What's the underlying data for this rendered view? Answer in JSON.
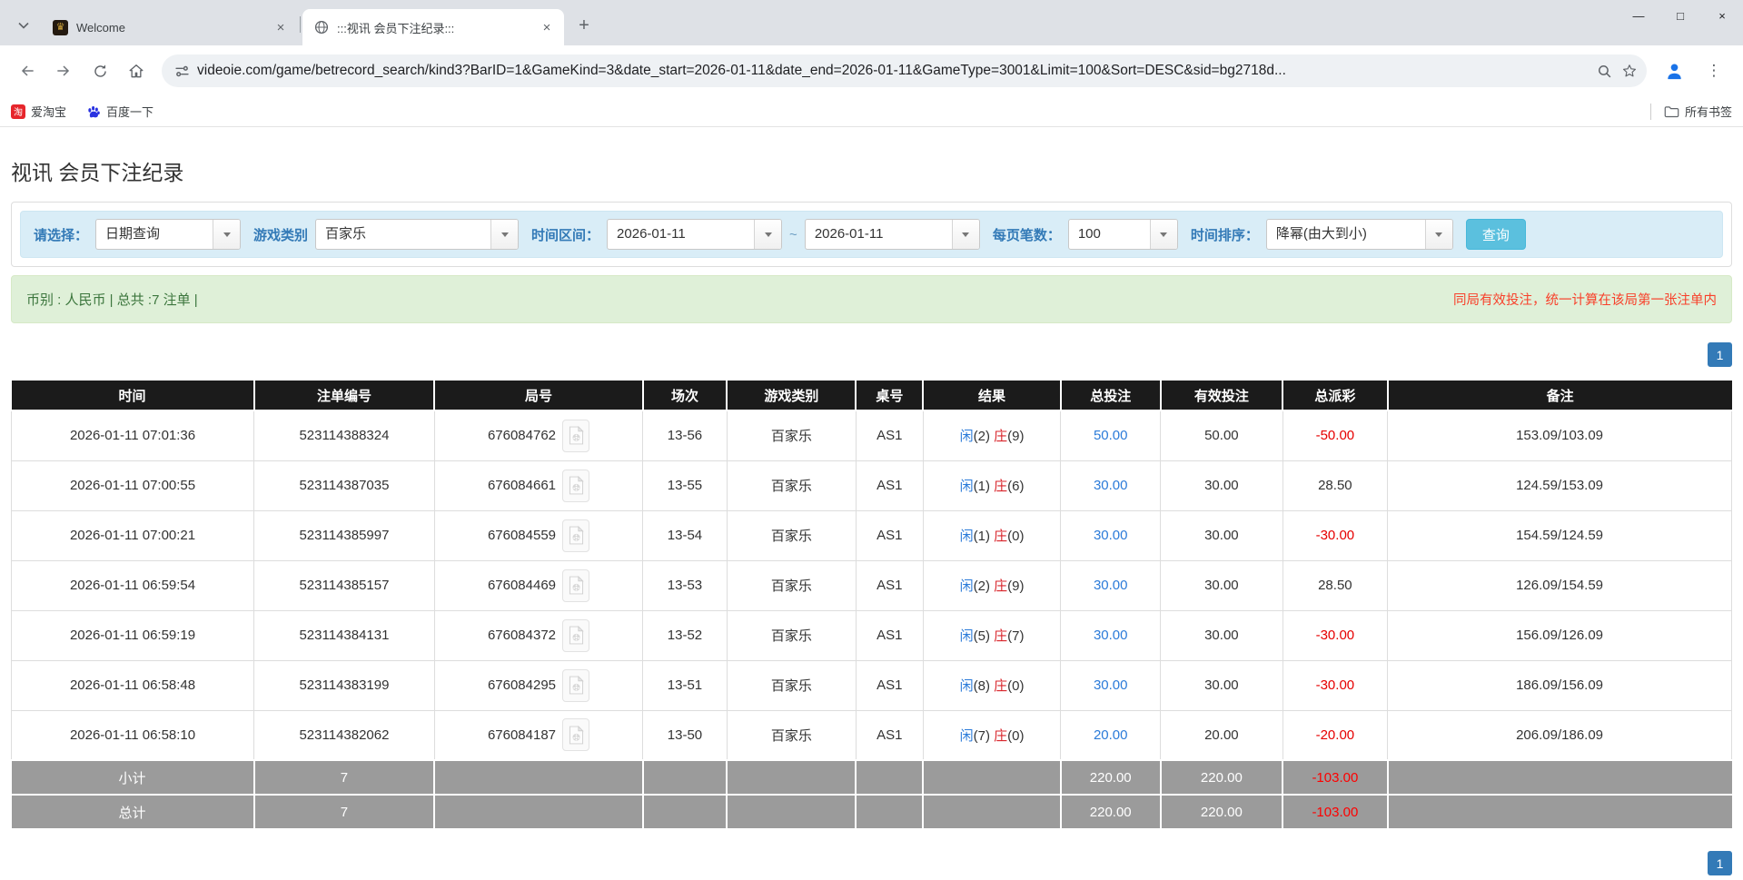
{
  "browser": {
    "tabs": [
      {
        "title": "Welcome"
      },
      {
        "title": ":::视讯 会员下注纪录:::"
      }
    ],
    "tab_close_glyph": "×",
    "new_tab_glyph": "+",
    "window_controls": {
      "minimize": "—",
      "maximize": "□",
      "close": "×"
    },
    "url": "videoie.com/game/betrecord_search/kind3?BarID=1&GameKind=3&date_start=2026-01-11&date_end=2026-01-11&GameType=3001&Limit=100&Sort=DESC&sid=bg2718d...",
    "bookmarks": [
      {
        "label": "爱淘宝",
        "icon": "taobao-icon",
        "icon_glyph": "淘"
      },
      {
        "label": "百度一下",
        "icon": "baidu-paw-icon"
      }
    ],
    "all_bookmarks": "所有书签"
  },
  "page": {
    "title": "视讯 会员下注纪录",
    "filters": {
      "select_label": "请选择：",
      "select_value": "日期查询",
      "game_kind_label": "游戏类别",
      "game_kind_value": "百家乐",
      "date_range_label": "时间区间：",
      "date_start": "2026-01-11",
      "tilde": "~",
      "date_end": "2026-01-11",
      "per_page_label": "每页笔数：",
      "per_page_value": "100",
      "sort_label": "时间排序：",
      "sort_value": "降幂(由大到小)",
      "search_button": "查询"
    },
    "summary_left": "币别 : 人民币 | 总共 :7 注单 |",
    "summary_right": "同局有效投注，统一计算在该局第一张注单内",
    "pagination": "1",
    "table": {
      "headers": [
        "时间",
        "注单编号",
        "局号",
        "场次",
        "游戏类别",
        "桌号",
        "结果",
        "总投注",
        "有效投注",
        "总派彩",
        "备注"
      ],
      "result_labels": {
        "player": "闲",
        "banker": "庄"
      },
      "rows": [
        {
          "time": "2026-01-11 07:01:36",
          "bet_id": "523114388324",
          "round_id": "676084762",
          "session": "13-56",
          "game": "百家乐",
          "table_no": "AS1",
          "player": "2",
          "banker": "9",
          "total_bet": "50.00",
          "valid_bet": "50.00",
          "payout": "-50.00",
          "remark": "153.09/103.09"
        },
        {
          "time": "2026-01-11 07:00:55",
          "bet_id": "523114387035",
          "round_id": "676084661",
          "session": "13-55",
          "game": "百家乐",
          "table_no": "AS1",
          "player": "1",
          "banker": "6",
          "total_bet": "30.00",
          "valid_bet": "30.00",
          "payout": "28.50",
          "remark": "124.59/153.09"
        },
        {
          "time": "2026-01-11 07:00:21",
          "bet_id": "523114385997",
          "round_id": "676084559",
          "session": "13-54",
          "game": "百家乐",
          "table_no": "AS1",
          "player": "1",
          "banker": "0",
          "total_bet": "30.00",
          "valid_bet": "30.00",
          "payout": "-30.00",
          "remark": "154.59/124.59"
        },
        {
          "time": "2026-01-11 06:59:54",
          "bet_id": "523114385157",
          "round_id": "676084469",
          "session": "13-53",
          "game": "百家乐",
          "table_no": "AS1",
          "player": "2",
          "banker": "9",
          "total_bet": "30.00",
          "valid_bet": "30.00",
          "payout": "28.50",
          "remark": "126.09/154.59"
        },
        {
          "time": "2026-01-11 06:59:19",
          "bet_id": "523114384131",
          "round_id": "676084372",
          "session": "13-52",
          "game": "百家乐",
          "table_no": "AS1",
          "player": "5",
          "banker": "7",
          "total_bet": "30.00",
          "valid_bet": "30.00",
          "payout": "-30.00",
          "remark": "156.09/126.09"
        },
        {
          "time": "2026-01-11 06:58:48",
          "bet_id": "523114383199",
          "round_id": "676084295",
          "session": "13-51",
          "game": "百家乐",
          "table_no": "AS1",
          "player": "8",
          "banker": "0",
          "total_bet": "30.00",
          "valid_bet": "30.00",
          "payout": "-30.00",
          "remark": "186.09/156.09"
        },
        {
          "time": "2026-01-11 06:58:10",
          "bet_id": "523114382062",
          "round_id": "676084187",
          "session": "13-50",
          "game": "百家乐",
          "table_no": "AS1",
          "player": "7",
          "banker": "0",
          "total_bet": "20.00",
          "valid_bet": "20.00",
          "payout": "-20.00",
          "remark": "206.09/186.09"
        }
      ],
      "totals": [
        {
          "label": "小计",
          "count": "7",
          "total_bet": "220.00",
          "valid_bet": "220.00",
          "payout": "-103.00"
        },
        {
          "label": "总计",
          "count": "7",
          "total_bet": "220.00",
          "valid_bet": "220.00",
          "payout": "-103.00"
        }
      ]
    }
  },
  "colors": {
    "accent_label_blue": "#337ab7",
    "link_blue": "#2b7bd9",
    "banker_red": "#d9262c",
    "negative_red": "#e60000",
    "note_red": "#f8402a",
    "search_button_bg": "#5bc0de",
    "table_header_bg": "#1b1b1b",
    "totals_bg": "#9b9b9b",
    "alert_bg": "#dff0d8",
    "filter_bar_bg": "#d9edf7"
  }
}
